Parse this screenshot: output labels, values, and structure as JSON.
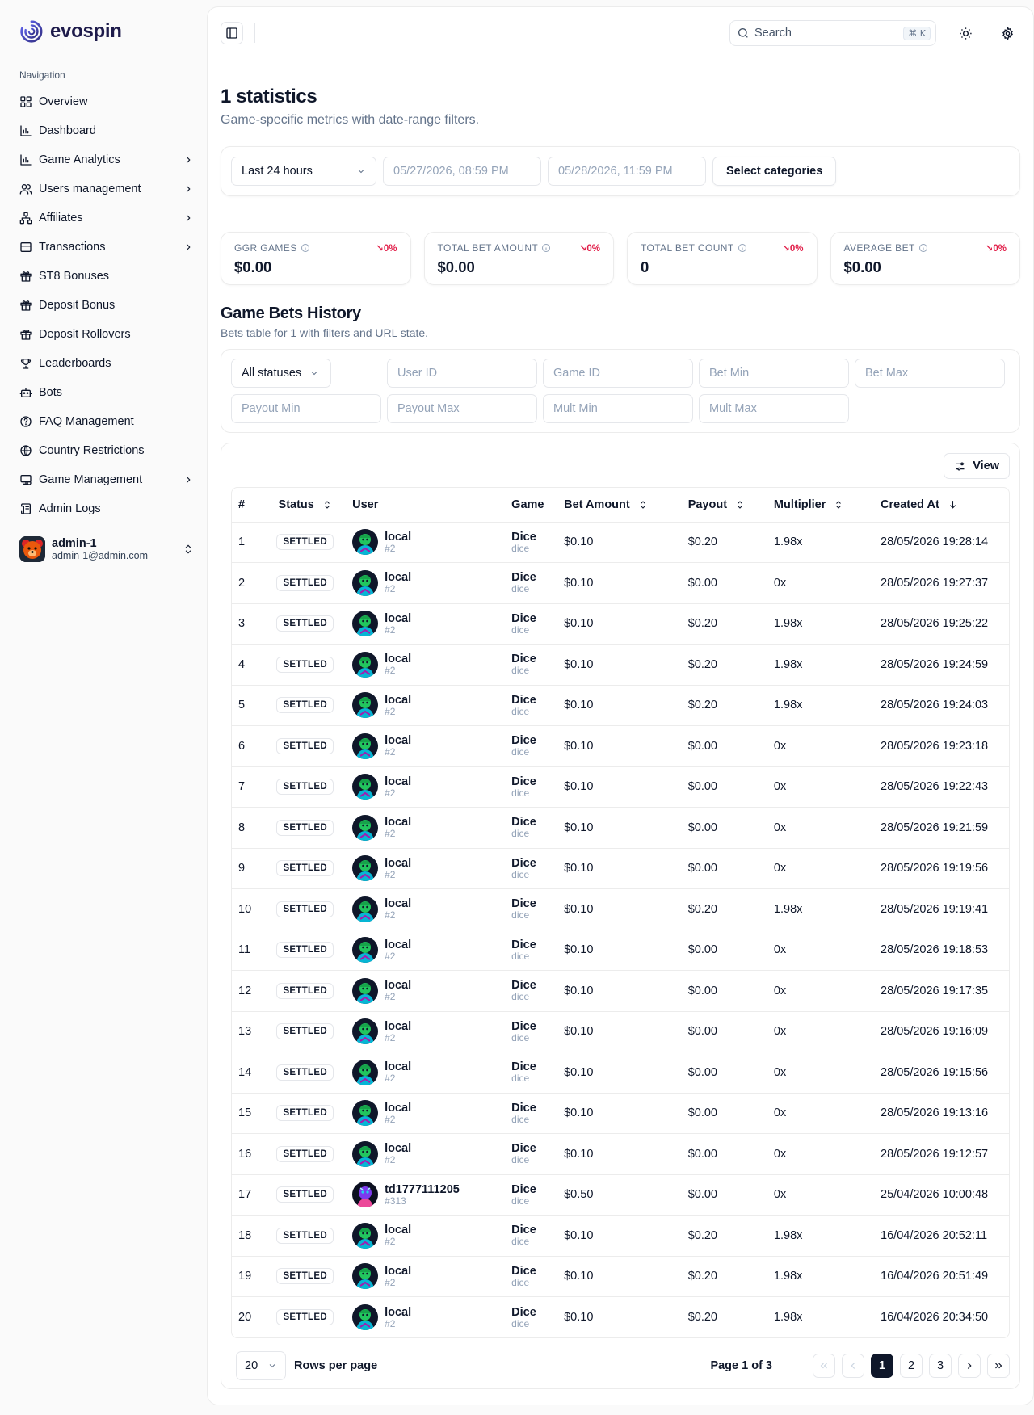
{
  "brand": {
    "name": "evospin"
  },
  "nav": {
    "heading": "Navigation",
    "items": [
      {
        "label": "Overview",
        "icon": "grid-icon",
        "chevron": false
      },
      {
        "label": "Dashboard",
        "icon": "bar-chart-icon",
        "chevron": false
      },
      {
        "label": "Game Analytics",
        "icon": "bar-chart-icon",
        "chevron": true
      },
      {
        "label": "Users management",
        "icon": "users-icon",
        "chevron": true
      },
      {
        "label": "Affiliates",
        "icon": "network-icon",
        "chevron": true
      },
      {
        "label": "Transactions",
        "icon": "receipt-icon",
        "chevron": true
      },
      {
        "label": "ST8 Bonuses",
        "icon": "gift-icon",
        "chevron": false
      },
      {
        "label": "Deposit Bonus",
        "icon": "gift-icon",
        "chevron": false
      },
      {
        "label": "Deposit Rollovers",
        "icon": "gift-icon",
        "chevron": false
      },
      {
        "label": "Leaderboards",
        "icon": "trophy-icon",
        "chevron": false
      },
      {
        "label": "Bots",
        "icon": "bot-icon",
        "chevron": false
      },
      {
        "label": "FAQ Management",
        "icon": "help-circle-icon",
        "chevron": false
      },
      {
        "label": "Country Restrictions",
        "icon": "globe-icon",
        "chevron": false
      },
      {
        "label": "Game Management",
        "icon": "monitor-icon",
        "chevron": true
      },
      {
        "label": "Admin Logs",
        "icon": "scroll-icon",
        "chevron": false
      }
    ]
  },
  "account": {
    "name": "admin-1",
    "email": "admin-1@admin.com"
  },
  "topbar": {
    "search_placeholder": "Search",
    "shortcut": "⌘ K"
  },
  "page": {
    "title": "1 statistics",
    "subtitle": "Game-specific metrics with date-range filters."
  },
  "filters": {
    "range": "Last 24 hours",
    "from": "05/27/2026, 08:59 PM",
    "to": "05/28/2026, 11:59 PM",
    "categories_button": "Select categories"
  },
  "stats": [
    {
      "label": "GGR GAMES",
      "value": "$0.00",
      "change": "↘0%"
    },
    {
      "label": "TOTAL BET AMOUNT",
      "value": "$0.00",
      "change": "↘0%"
    },
    {
      "label": "TOTAL BET COUNT",
      "value": "0",
      "change": "↘0%"
    },
    {
      "label": "AVERAGE BET",
      "value": "$0.00",
      "change": "↘0%"
    }
  ],
  "history": {
    "title": "Game Bets History",
    "subtitle": "Bets table for 1 with filters and URL state.",
    "status_select": "All statuses",
    "filter_placeholders": [
      "User ID",
      "Game ID",
      "Bet Min",
      "Bet Max",
      "Payout Min",
      "Payout Max",
      "Mult Min",
      "Mult Max"
    ],
    "view_button": "View",
    "columns": [
      "#",
      "Status",
      "User",
      "Game",
      "Bet Amount",
      "Payout",
      "Multiplier",
      "Created At"
    ],
    "rows": [
      {
        "n": "1",
        "status": "SETTLED",
        "user": "local",
        "uid": "#2",
        "game": "Dice",
        "slug": "dice",
        "bet": "$0.10",
        "payout": "$0.20",
        "mult": "1.98x",
        "created": "28/05/2026 19:28:14"
      },
      {
        "n": "2",
        "status": "SETTLED",
        "user": "local",
        "uid": "#2",
        "game": "Dice",
        "slug": "dice",
        "bet": "$0.10",
        "payout": "$0.00",
        "mult": "0x",
        "created": "28/05/2026 19:27:37"
      },
      {
        "n": "3",
        "status": "SETTLED",
        "user": "local",
        "uid": "#2",
        "game": "Dice",
        "slug": "dice",
        "bet": "$0.10",
        "payout": "$0.20",
        "mult": "1.98x",
        "created": "28/05/2026 19:25:22"
      },
      {
        "n": "4",
        "status": "SETTLED",
        "user": "local",
        "uid": "#2",
        "game": "Dice",
        "slug": "dice",
        "bet": "$0.10",
        "payout": "$0.20",
        "mult": "1.98x",
        "created": "28/05/2026 19:24:59"
      },
      {
        "n": "5",
        "status": "SETTLED",
        "user": "local",
        "uid": "#2",
        "game": "Dice",
        "slug": "dice",
        "bet": "$0.10",
        "payout": "$0.20",
        "mult": "1.98x",
        "created": "28/05/2026 19:24:03"
      },
      {
        "n": "6",
        "status": "SETTLED",
        "user": "local",
        "uid": "#2",
        "game": "Dice",
        "slug": "dice",
        "bet": "$0.10",
        "payout": "$0.00",
        "mult": "0x",
        "created": "28/05/2026 19:23:18"
      },
      {
        "n": "7",
        "status": "SETTLED",
        "user": "local",
        "uid": "#2",
        "game": "Dice",
        "slug": "dice",
        "bet": "$0.10",
        "payout": "$0.00",
        "mult": "0x",
        "created": "28/05/2026 19:22:43"
      },
      {
        "n": "8",
        "status": "SETTLED",
        "user": "local",
        "uid": "#2",
        "game": "Dice",
        "slug": "dice",
        "bet": "$0.10",
        "payout": "$0.00",
        "mult": "0x",
        "created": "28/05/2026 19:21:59"
      },
      {
        "n": "9",
        "status": "SETTLED",
        "user": "local",
        "uid": "#2",
        "game": "Dice",
        "slug": "dice",
        "bet": "$0.10",
        "payout": "$0.00",
        "mult": "0x",
        "created": "28/05/2026 19:19:56"
      },
      {
        "n": "10",
        "status": "SETTLED",
        "user": "local",
        "uid": "#2",
        "game": "Dice",
        "slug": "dice",
        "bet": "$0.10",
        "payout": "$0.20",
        "mult": "1.98x",
        "created": "28/05/2026 19:19:41"
      },
      {
        "n": "11",
        "status": "SETTLED",
        "user": "local",
        "uid": "#2",
        "game": "Dice",
        "slug": "dice",
        "bet": "$0.10",
        "payout": "$0.00",
        "mult": "0x",
        "created": "28/05/2026 19:18:53"
      },
      {
        "n": "12",
        "status": "SETTLED",
        "user": "local",
        "uid": "#2",
        "game": "Dice",
        "slug": "dice",
        "bet": "$0.10",
        "payout": "$0.00",
        "mult": "0x",
        "created": "28/05/2026 19:17:35"
      },
      {
        "n": "13",
        "status": "SETTLED",
        "user": "local",
        "uid": "#2",
        "game": "Dice",
        "slug": "dice",
        "bet": "$0.10",
        "payout": "$0.00",
        "mult": "0x",
        "created": "28/05/2026 19:16:09"
      },
      {
        "n": "14",
        "status": "SETTLED",
        "user": "local",
        "uid": "#2",
        "game": "Dice",
        "slug": "dice",
        "bet": "$0.10",
        "payout": "$0.00",
        "mult": "0x",
        "created": "28/05/2026 19:15:56"
      },
      {
        "n": "15",
        "status": "SETTLED",
        "user": "local",
        "uid": "#2",
        "game": "Dice",
        "slug": "dice",
        "bet": "$0.10",
        "payout": "$0.00",
        "mult": "0x",
        "created": "28/05/2026 19:13:16"
      },
      {
        "n": "16",
        "status": "SETTLED",
        "user": "local",
        "uid": "#2",
        "game": "Dice",
        "slug": "dice",
        "bet": "$0.10",
        "payout": "$0.00",
        "mult": "0x",
        "created": "28/05/2026 19:12:57"
      },
      {
        "n": "17",
        "status": "SETTLED",
        "user": "td1777111205",
        "uid": "#313",
        "game": "Dice",
        "slug": "dice",
        "bet": "$0.50",
        "payout": "$0.00",
        "mult": "0x",
        "created": "25/04/2026 10:00:48"
      },
      {
        "n": "18",
        "status": "SETTLED",
        "user": "local",
        "uid": "#2",
        "game": "Dice",
        "slug": "dice",
        "bet": "$0.10",
        "payout": "$0.20",
        "mult": "1.98x",
        "created": "16/04/2026 20:52:11"
      },
      {
        "n": "19",
        "status": "SETTLED",
        "user": "local",
        "uid": "#2",
        "game": "Dice",
        "slug": "dice",
        "bet": "$0.10",
        "payout": "$0.20",
        "mult": "1.98x",
        "created": "16/04/2026 20:51:49"
      },
      {
        "n": "20",
        "status": "SETTLED",
        "user": "local",
        "uid": "#2",
        "game": "Dice",
        "slug": "dice",
        "bet": "$0.10",
        "payout": "$0.20",
        "mult": "1.98x",
        "created": "16/04/2026 20:34:50"
      }
    ]
  },
  "pagination": {
    "rows_per_page": "20",
    "rows_per_page_label": "Rows per page",
    "page_info": "Page 1 of 3",
    "pages": [
      "1",
      "2",
      "3"
    ]
  },
  "colors": {
    "accent": "#0f172a",
    "negative": "#e11d48",
    "brand": "#4f46e5"
  }
}
